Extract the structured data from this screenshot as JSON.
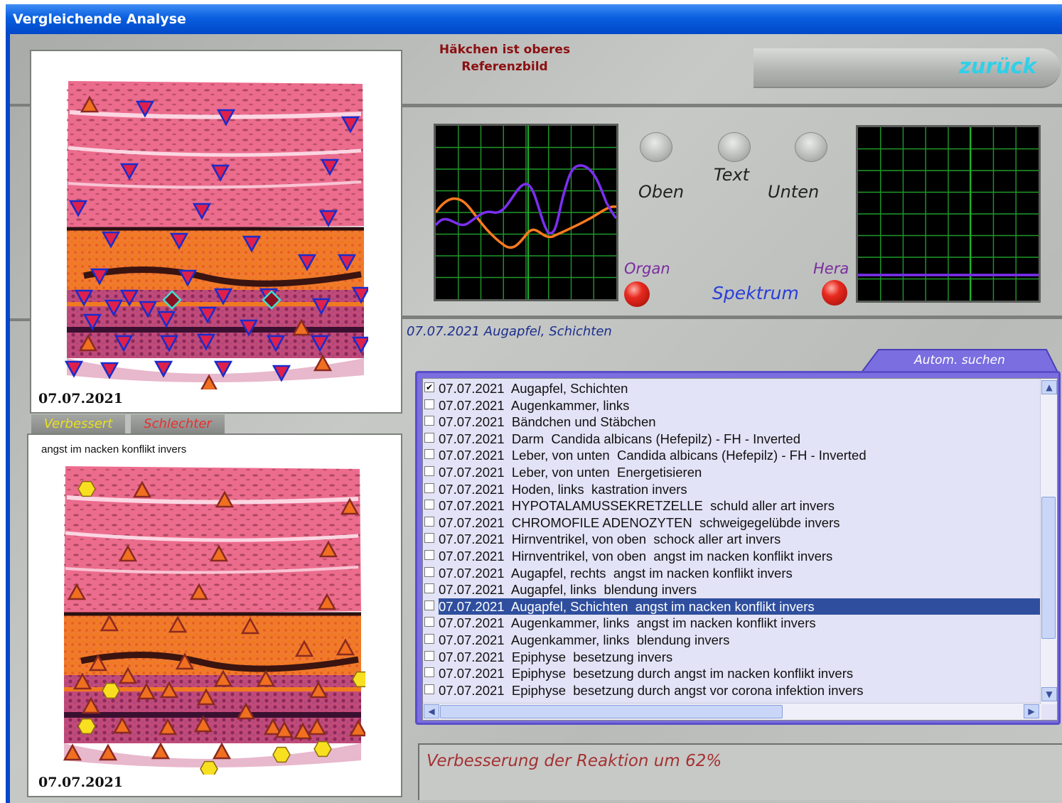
{
  "window": {
    "title": "Vergleichende Analyse"
  },
  "reference_note": {
    "line1": "Häkchen ist oberes",
    "line2": "Referenzbild"
  },
  "back_button": "zurück",
  "upper_image": {
    "date": "07.07.2021"
  },
  "tabs": {
    "improved": "Verbessert",
    "worse": "Schlechter"
  },
  "lower_image": {
    "caption": "angst im nacken konflikt invers",
    "date": "07.07.2021"
  },
  "controls": {
    "top": "Oben",
    "text": "Text",
    "bottom": "Unten",
    "organ": "Organ",
    "hera": "Hera",
    "spectrum": "Spektrum"
  },
  "current_label": "07.07.2021 Augapfel, Schichten",
  "auto_search": "Autom. suchen",
  "list": {
    "selected_index": 13,
    "items": [
      {
        "date": "07.07.2021",
        "text": "Augapfel, Schichten",
        "checked": true
      },
      {
        "date": "07.07.2021",
        "text": "Augenkammer, links",
        "checked": false
      },
      {
        "date": "07.07.2021",
        "text": "Bändchen und Stäbchen",
        "checked": false
      },
      {
        "date": "07.07.2021",
        "text": "Darm  Candida albicans (Hefepilz) - FH - Inverted",
        "checked": false
      },
      {
        "date": "07.07.2021",
        "text": "Leber, von unten  Candida albicans (Hefepilz) - FH - Inverted",
        "checked": false
      },
      {
        "date": "07.07.2021",
        "text": "Leber, von unten  Energetisieren",
        "checked": false
      },
      {
        "date": "07.07.2021",
        "text": "Hoden, links  kastration invers",
        "checked": false
      },
      {
        "date": "07.07.2021",
        "text": "HYPOTALAMUSSEKRETZELLE  schuld aller art invers",
        "checked": false
      },
      {
        "date": "07.07.2021",
        "text": "CHROMOFILE ADENOZYTEN  schweigegelübde invers",
        "checked": false
      },
      {
        "date": "07.07.2021",
        "text": "Hirnventrikel, von oben  schock aller art invers",
        "checked": false
      },
      {
        "date": "07.07.2021",
        "text": "Hirnventrikel, von oben  angst im nacken konflikt invers",
        "checked": false
      },
      {
        "date": "07.07.2021",
        "text": "Augapfel, rechts  angst im nacken konflikt invers",
        "checked": false
      },
      {
        "date": "07.07.2021",
        "text": "Augapfel, links  blendung invers",
        "checked": false
      },
      {
        "date": "07.07.2021",
        "text": "Augapfel, Schichten  angst im nacken konflikt invers",
        "checked": false
      },
      {
        "date": "07.07.2021",
        "text": "Augenkammer, links  angst im nacken konflikt invers",
        "checked": false
      },
      {
        "date": "07.07.2021",
        "text": "Augenkammer, links  blendung invers",
        "checked": false
      },
      {
        "date": "07.07.2021",
        "text": "Epiphyse  besetzung invers",
        "checked": false
      },
      {
        "date": "07.07.2021",
        "text": "Epiphyse  besetzung durch angst im nacken konflikt invers",
        "checked": false
      },
      {
        "date": "07.07.2021",
        "text": "Epiphyse  besetzung durch angst vor corona infektion invers",
        "checked": false
      }
    ]
  },
  "status": "Verbesserung der Reaktion um 62%",
  "colors": {
    "titlebar": "#0a5fe0",
    "back": "#2fd0e8",
    "selection": "#2f4f9e",
    "tab_improved": "#e8e020",
    "tab_worse": "#e83030",
    "scope_grid": "#1f9a2a",
    "trace_orange": "#ff7a1e",
    "trace_purple": "#7b2ff0"
  }
}
